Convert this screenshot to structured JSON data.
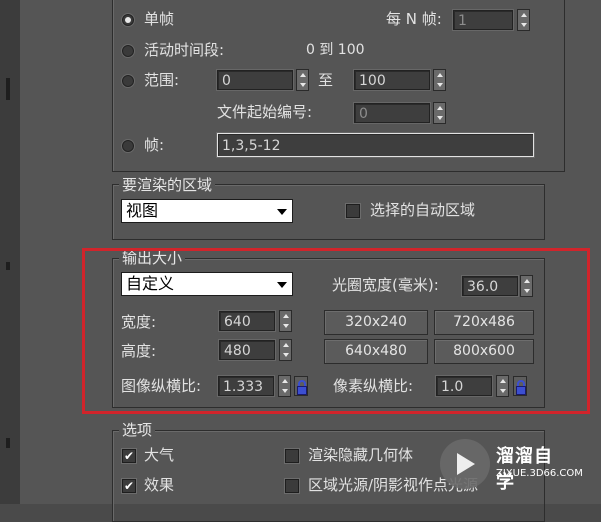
{
  "time_output": {
    "single_frame": "单帧",
    "every_n_frames_label": "每 N 帧:",
    "every_n_frames_value": "1",
    "active_segment": "活动时间段:",
    "active_segment_range": "0 到 100",
    "range_label": "范围:",
    "range_from": "0",
    "range_to_label": "至",
    "range_to": "100",
    "file_number_base_label": "文件起始编号:",
    "file_number_base_value": "0",
    "frames_label": "帧:",
    "frames_value": "1,3,5-12"
  },
  "area_to_render": {
    "title": "要渲染的区域",
    "selected": "视图",
    "auto_region_label": "选择的自动区域"
  },
  "output_size": {
    "title": "输出大小",
    "preset": "自定义",
    "aperture_label": "光圈宽度(毫米):",
    "aperture_value": "36.0",
    "width_label": "宽度:",
    "width_value": "640",
    "height_label": "高度:",
    "height_value": "480",
    "presets": [
      "320x240",
      "720x486",
      "640x480",
      "800x600"
    ],
    "image_aspect_label": "图像纵横比:",
    "image_aspect_value": "1.333",
    "pixel_aspect_label": "像素纵横比:",
    "pixel_aspect_value": "1.0"
  },
  "options": {
    "title": "选项",
    "atmospherics": "大气",
    "effects": "效果",
    "render_hidden": "渲染隐藏几何体",
    "area_lights": "区域光源/阴影视作点光源"
  },
  "watermark": {
    "title": "溜溜自学",
    "url": "ZIXUE.3D66.COM"
  },
  "colors": {
    "highlight": "#d1242b",
    "lock_icon": "#3c4fd0"
  }
}
